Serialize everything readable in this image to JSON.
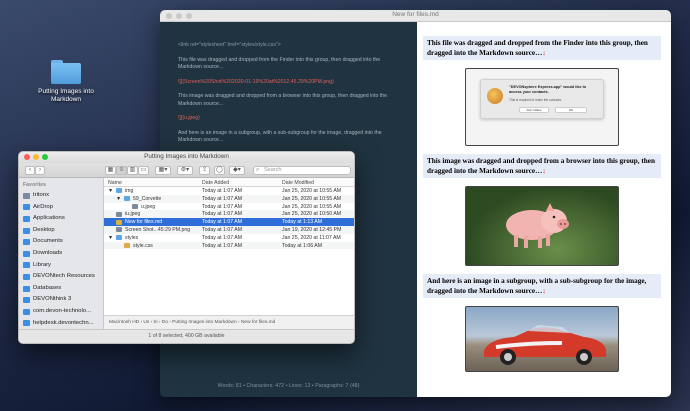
{
  "desktop": {
    "folder_label": "Putting Images into Markdown"
  },
  "editor": {
    "title": "New for files.md",
    "source": {
      "line1": "<link rel=\"stylesheet\" href=\"styles/style.css\">",
      "para1": "This file was dragged and dropped from the Finder into this group, then dragged into the Markdown source...",
      "img1": "![](Screen%20Shot%202020-01-19%20at%2012.45.29%20PM.png)",
      "para2": "This image was dragged and dropped from a browser into this group, then dragged into the Markdown source...",
      "img2": "![](u.jpeg)",
      "para3": "And here is an image in a subgroup, with a sub-subgroup for the image, dragged into the Markdown source...",
      "img3": "![](img/59_Corvette/u.jpeg)"
    },
    "stats": "Words: 81 • Characters: 472 • Lines: 13 • Paragraphs: 7 (48)",
    "preview": {
      "head1": "This file was dragged and dropped from the Finder into this group, then dragged into the Markdown source…",
      "head2": "This image was dragged and dropped from a browser into this group, then dragged into the Markdown source…",
      "head3": "And here is an image in a subgroup, with a sub-subgroup for the image, dragged into the Markdown source…",
      "arrow": "↓",
      "dialog_title": "\"DEVONsphere Express.app\" would like to access your contacts.",
      "dialog_sub": "This is required to index the contacts.",
      "dialog_btn1": "Don't Allow",
      "dialog_btn2": "OK"
    }
  },
  "finder": {
    "title": "Putting Images into Markdown",
    "search_placeholder": "Search",
    "favorites_label": "Favorites",
    "sidebar": [
      {
        "label": "tritonx",
        "color": "#7a8aa0"
      },
      {
        "label": "AirDrop",
        "color": "#3a8ee6"
      },
      {
        "label": "Applications",
        "color": "#3a8ee6"
      },
      {
        "label": "Desktop",
        "color": "#3a8ee6"
      },
      {
        "label": "Documents",
        "color": "#3a8ee6"
      },
      {
        "label": "Downloads",
        "color": "#3a8ee6"
      },
      {
        "label": "Library",
        "color": "#3a8ee6"
      },
      {
        "label": "DEVONtech Resources",
        "color": "#3a8ee6"
      },
      {
        "label": "Databases",
        "color": "#3a8ee6"
      },
      {
        "label": "DEVONthink 3",
        "color": "#3a8ee6"
      },
      {
        "label": "com.devon-technolo...",
        "color": "#3a8ee6"
      },
      {
        "label": "helpdesk.devontechn...",
        "color": "#3a8ee6"
      },
      {
        "label": "Coding",
        "color": "#3a8ee6"
      }
    ],
    "columns": {
      "name": "Name",
      "added": "Date Added",
      "modified": "Date Modified"
    },
    "rows": [
      {
        "name": "img",
        "tri": "▼",
        "added": "Today at 1:07 AM",
        "modified": "Jan 25, 2020 at 10:55 AM",
        "kind": "folder",
        "indent": 0
      },
      {
        "name": "59_Corvette",
        "tri": "▼",
        "added": "Today at 1:07 AM",
        "modified": "Jan 25, 2020 at 10:55 AM",
        "kind": "folder",
        "indent": 1
      },
      {
        "name": "u.jpeg",
        "tri": "",
        "added": "Today at 1:07 AM",
        "modified": "Jan 25, 2020 at 10:55 AM",
        "kind": "image",
        "indent": 2
      },
      {
        "name": "iu.jpeg",
        "tri": "",
        "added": "Today at 1:07 AM",
        "modified": "Jan 25, 2020 at 10:50 AM",
        "kind": "image",
        "indent": 0
      },
      {
        "name": "New for files.md",
        "tri": "",
        "added": "Today at 1:07 AM",
        "modified": "Today at 1:13 AM",
        "kind": "md",
        "indent": 0,
        "selected": true
      },
      {
        "name": "Screen Shot...45:29 PM.png",
        "tri": "",
        "added": "Today at 1:07 AM",
        "modified": "Jan 19, 2020 at 12:45 PM",
        "kind": "image",
        "indent": 0
      },
      {
        "name": "styles",
        "tri": "▼",
        "added": "Today at 1:07 AM",
        "modified": "Jan 25, 2020 at 11:07 AM",
        "kind": "folder",
        "indent": 0
      },
      {
        "name": "style.css",
        "tri": "",
        "added": "Today at 1:07 AM",
        "modified": "Today at 1:06 AM",
        "kind": "css",
        "indent": 1
      }
    ],
    "path": "Macintosh HD › Us › tri › Do › Putting Images into Markdown › New for files.md",
    "status": "1 of 8 selected, 400 GB available"
  },
  "colors": {
    "selection": "#2f6ed8",
    "red_link": "#e0625a",
    "preview_head_bg": "#e6ebf8"
  }
}
